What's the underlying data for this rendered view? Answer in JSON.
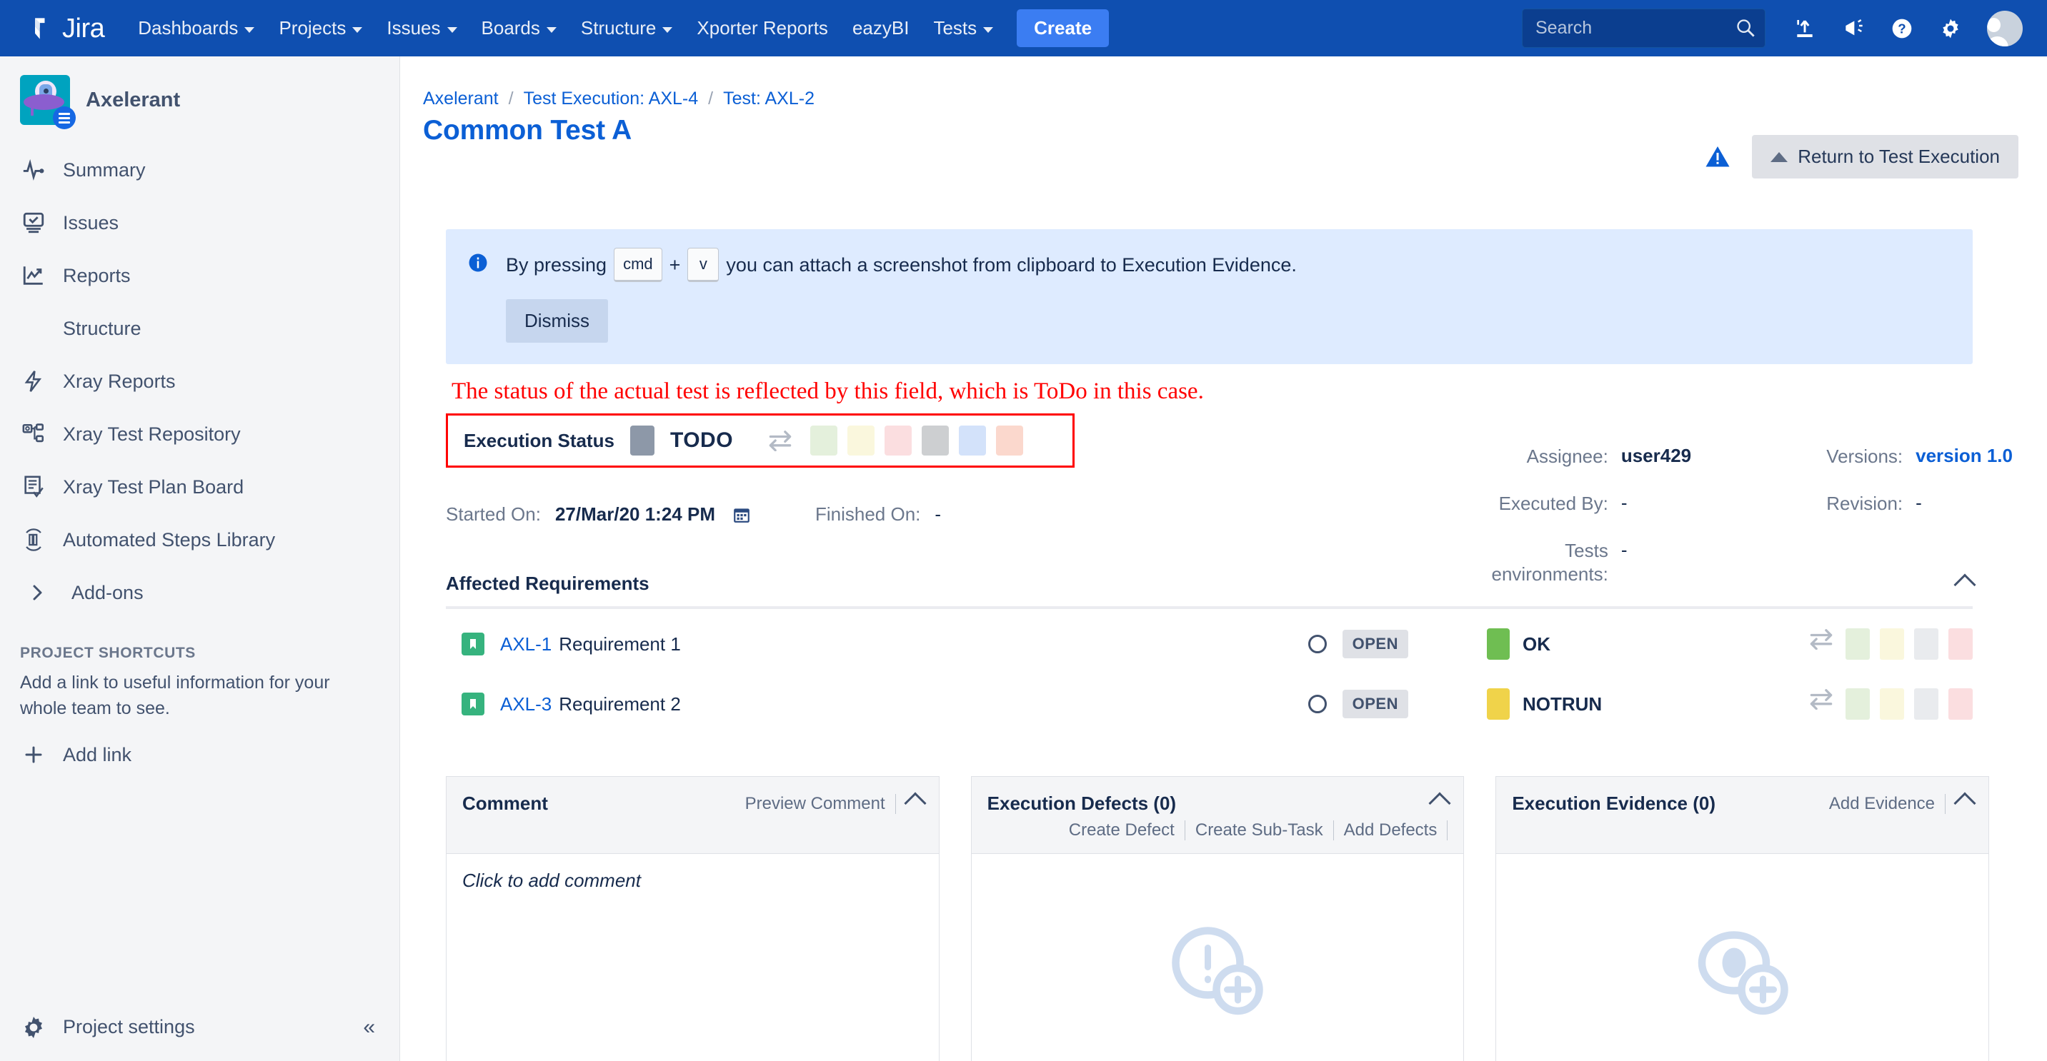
{
  "topnav": {
    "brand": "Jira",
    "items": [
      {
        "label": "Dashboards",
        "has_caret": true
      },
      {
        "label": "Projects",
        "has_caret": true
      },
      {
        "label": "Issues",
        "has_caret": true
      },
      {
        "label": "Boards",
        "has_caret": true
      },
      {
        "label": "Structure",
        "has_caret": true
      },
      {
        "label": "Xporter Reports",
        "has_caret": false
      },
      {
        "label": "eazyBI",
        "has_caret": false
      },
      {
        "label": "Tests",
        "has_caret": true
      }
    ],
    "create_label": "Create",
    "search_placeholder": "Search",
    "icons": [
      "upload-icon",
      "announcement-icon",
      "help-icon",
      "settings-gear-icon",
      "avatar"
    ]
  },
  "sidebar": {
    "project_name": "Axelerant",
    "items": [
      {
        "label": "Summary",
        "icon": "pulse-icon"
      },
      {
        "label": "Issues",
        "icon": "issues-icon"
      },
      {
        "label": "Reports",
        "icon": "reports-trend-icon"
      },
      {
        "label": "Structure",
        "icon": "none"
      },
      {
        "label": "Xray Reports",
        "icon": "lightning-icon"
      },
      {
        "label": "Xray Test Repository",
        "icon": "repository-icon"
      },
      {
        "label": "Xray Test Plan Board",
        "icon": "testplan-icon"
      },
      {
        "label": "Automated Steps Library",
        "icon": "library-icon"
      },
      {
        "label": "Add-ons",
        "icon": "chevron-right-icon"
      }
    ],
    "shortcuts_heading": "PROJECT SHORTCUTS",
    "shortcuts_description": "Add a link to useful information for your whole team to see.",
    "add_link_label": "Add link",
    "project_settings_label": "Project settings",
    "collapse_label": "«"
  },
  "header": {
    "breadcrumbs": [
      "Axelerant",
      "Test Execution: AXL-4",
      "Test: AXL-2"
    ],
    "breadcrumb_separator": "/",
    "title": "Common Test A",
    "return_button": "Return to Test Execution"
  },
  "banner": {
    "text_before": "By pressing",
    "key1": "cmd",
    "plus": "+",
    "key2": "v",
    "text_after": "you can attach a screenshot from clipboard to Execution Evidence.",
    "dismiss_label": "Dismiss"
  },
  "annotation": {
    "text": "The status of the actual test is reflected by this field, which is ToDo in this case.",
    "color": "#FF0000"
  },
  "execution_status": {
    "label": "Execution Status",
    "value": "TODO",
    "chip_color": "#8D98A8",
    "swatches": [
      "#E4F0DC",
      "#FAF7DD",
      "#FBDEE0",
      "#CDCFD1",
      "#D3E2FA",
      "#FBD8CD"
    ]
  },
  "fields": {
    "left": [
      {
        "label": "Assignee:",
        "value": "user429",
        "style": "bold"
      },
      {
        "label": "Executed By:",
        "value": "-",
        "style": "plain"
      },
      {
        "label": "Tests environments:",
        "value": "-",
        "style": "plain"
      }
    ],
    "right": [
      {
        "label": "Versions:",
        "value": "version 1.0",
        "style": "link"
      },
      {
        "label": "Revision:",
        "value": "-",
        "style": "plain"
      }
    ]
  },
  "dates": {
    "started_label": "Started On:",
    "started_value": "27/Mar/20 1:24 PM",
    "finished_label": "Finished On:",
    "finished_value": "-"
  },
  "affected_requirements": {
    "heading": "Affected Requirements",
    "rows": [
      {
        "key": "AXL-1",
        "summary": "Requirement 1",
        "workflow_status": "OPEN",
        "test_status": "OK",
        "chip_color": "#6FBE52",
        "swatches": [
          "#E4F0DC",
          "#FAF7DD",
          "#E9EBEE",
          "#FBDEE0"
        ]
      },
      {
        "key": "AXL-3",
        "summary": "Requirement 2",
        "workflow_status": "OPEN",
        "test_status": "NOTRUN",
        "chip_color": "#F0D34A",
        "swatches": [
          "#E4F0DC",
          "#FAF7DD",
          "#E9EBEE",
          "#FBDEE0"
        ]
      }
    ]
  },
  "panels": {
    "comment": {
      "title": "Comment",
      "action": "Preview Comment",
      "placeholder": "Click to add comment"
    },
    "defects": {
      "title": "Execution Defects (0)",
      "actions": [
        "Create Defect",
        "Create Sub-Task",
        "Add Defects"
      ],
      "illustration": "add-defect-icon"
    },
    "evidence": {
      "title": "Execution Evidence (0)",
      "actions": [
        "Add Evidence"
      ],
      "illustration": "add-evidence-eye-icon"
    }
  }
}
